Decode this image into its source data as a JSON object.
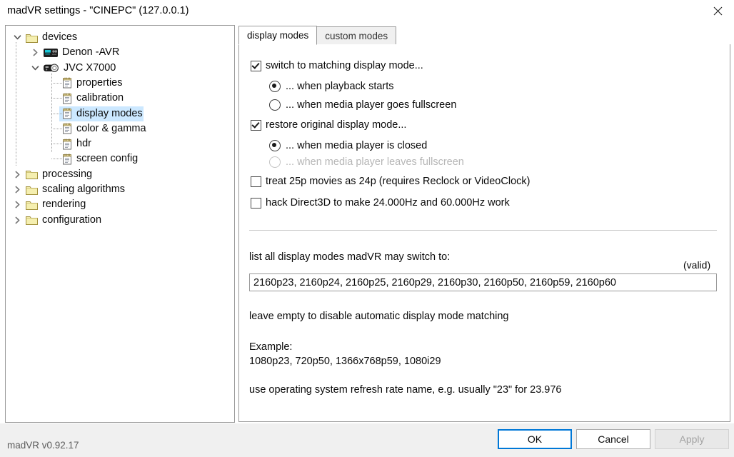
{
  "window": {
    "title": "madVR settings - \"CINEPC\" (127.0.0.1)",
    "close_icon": "close-icon"
  },
  "tree": {
    "nodes": [
      {
        "label": "devices",
        "icon": "folder-icon",
        "expander": "chevron-down-icon",
        "depth": 0,
        "selected": false
      },
      {
        "label": "Denon -AVR",
        "icon": "receiver-icon",
        "expander": "chevron-right-icon",
        "depth": 1,
        "selected": false
      },
      {
        "label": "JVC X7000",
        "icon": "projector-icon",
        "expander": "chevron-down-icon",
        "depth": 1,
        "selected": false
      },
      {
        "label": "properties",
        "icon": "notepad-icon",
        "expander": "none",
        "depth": 2,
        "selected": false
      },
      {
        "label": "calibration",
        "icon": "notepad-icon",
        "expander": "none",
        "depth": 2,
        "selected": false
      },
      {
        "label": "display modes",
        "icon": "notepad-icon",
        "expander": "none",
        "depth": 2,
        "selected": true
      },
      {
        "label": "color & gamma",
        "icon": "notepad-icon",
        "expander": "none",
        "depth": 2,
        "selected": false
      },
      {
        "label": "hdr",
        "icon": "notepad-icon",
        "expander": "none",
        "depth": 2,
        "selected": false
      },
      {
        "label": "screen config",
        "icon": "notepad-icon",
        "expander": "none",
        "depth": 2,
        "selected": false
      },
      {
        "label": "processing",
        "icon": "folder-icon",
        "expander": "chevron-right-icon",
        "depth": 0,
        "selected": false
      },
      {
        "label": "scaling algorithms",
        "icon": "folder-icon",
        "expander": "chevron-right-icon",
        "depth": 0,
        "selected": false
      },
      {
        "label": "rendering",
        "icon": "folder-icon",
        "expander": "chevron-right-icon",
        "depth": 0,
        "selected": false
      },
      {
        "label": "configuration",
        "icon": "folder-icon",
        "expander": "chevron-right-icon",
        "depth": 0,
        "selected": false
      }
    ]
  },
  "tabs": [
    {
      "label": "display modes",
      "active": true
    },
    {
      "label": "custom modes",
      "active": false
    }
  ],
  "options": {
    "switch_mode": {
      "label": "switch to matching display mode...",
      "checked": true
    },
    "switch_playback": {
      "label": "... when playback starts",
      "selected": true,
      "disabled": false
    },
    "switch_fullscreen": {
      "label": "... when media player goes fullscreen",
      "selected": false,
      "disabled": false
    },
    "restore_mode": {
      "label": "restore original display mode...",
      "checked": true
    },
    "restore_closed": {
      "label": "... when media player is closed",
      "selected": true,
      "disabled": false
    },
    "restore_fullscreen": {
      "label": "... when media player leaves fullscreen",
      "selected": false,
      "disabled": true
    },
    "treat_25p": {
      "label": "treat 25p movies as 24p  (requires Reclock or VideoClock)",
      "checked": false
    },
    "hack_d3d": {
      "label": "hack Direct3D to make 24.000Hz and 60.000Hz work",
      "checked": false
    }
  },
  "modes": {
    "list_label": "list all display modes madVR may switch to:",
    "valid_label": "(valid)",
    "value": "2160p23, 2160p24, 2160p25, 2160p29, 2160p30, 2160p50, 2160p59, 2160p60",
    "placeholder": "",
    "hint_empty": "leave empty to disable automatic display mode matching",
    "example_title": "Example:",
    "example_value": "1080p23, 720p50, 1366x768p59, 1080i29",
    "hint_refresh": "use operating system refresh rate name, e.g. usually \"23\" for 23.976"
  },
  "footer": {
    "version": "madVR v0.92.17",
    "ok": "OK",
    "cancel": "Cancel",
    "apply": "Apply"
  },
  "colors": {
    "selection": "#cce8ff",
    "focus_border": "#0078d7",
    "panel_border": "#9a9a9a",
    "bottom_bar": "#f0f0f0"
  }
}
